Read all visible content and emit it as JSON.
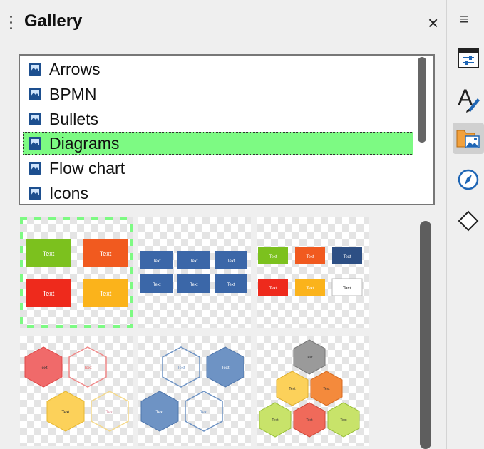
{
  "panel": {
    "title": "Gallery",
    "close_glyph": "×",
    "menu_glyph": "≡"
  },
  "themes": [
    {
      "label": "Arrows",
      "selected": false
    },
    {
      "label": "BPMN",
      "selected": false
    },
    {
      "label": "Bullets",
      "selected": false
    },
    {
      "label": "Diagrams",
      "selected": true
    },
    {
      "label": "Flow chart",
      "selected": false
    },
    {
      "label": "Icons",
      "selected": false
    }
  ],
  "items": [
    {
      "name": "diagram-2x2-blocks",
      "boxes": [
        {
          "label": "Text",
          "color": "#7cc11e"
        },
        {
          "label": "Text",
          "color": "#f15a1f"
        },
        {
          "label": "Text",
          "color": "#ee2a1c"
        },
        {
          "label": "Text",
          "color": "#fbb31b"
        }
      ]
    },
    {
      "name": "diagram-blue-grid",
      "boxes": [
        {
          "label": "Text",
          "color": "#3b67a8"
        },
        {
          "label": "Text",
          "color": "#3b67a8"
        },
        {
          "label": "Text",
          "color": "#3b67a8"
        },
        {
          "label": "Text",
          "color": "#3b67a8"
        },
        {
          "label": "Text",
          "color": "#3b67a8"
        },
        {
          "label": "Text",
          "color": "#3b67a8"
        }
      ]
    },
    {
      "name": "diagram-color-grid",
      "boxes": [
        {
          "label": "Text",
          "color": "#7cc11e"
        },
        {
          "label": "Text",
          "color": "#f15a1f"
        },
        {
          "label": "Text",
          "color": "#2d4f84"
        },
        {
          "label": "Text",
          "color": "#ee2a1c"
        },
        {
          "label": "Text",
          "color": "#fbb31b"
        },
        {
          "label": "Text",
          "color": "#ffffff"
        }
      ]
    },
    {
      "name": "diagram-warm-hexagons",
      "hexes": [
        {
          "label": "Text",
          "color": "#f06a6a"
        },
        {
          "label": "Text",
          "color": "outline-red"
        },
        {
          "label": "Text",
          "color": "#fcd15a"
        },
        {
          "label": "Text",
          "color": "outline-yellow"
        }
      ]
    },
    {
      "name": "diagram-blue-hexagons",
      "hexes": [
        {
          "label": "Text",
          "color": "outline-blue"
        },
        {
          "label": "Text",
          "color": "#6e93c4"
        },
        {
          "label": "Text",
          "color": "#6e93c4"
        },
        {
          "label": "Text",
          "color": "outline-blue"
        }
      ]
    },
    {
      "name": "diagram-hex-pyramid",
      "hexes": [
        {
          "label": "Text",
          "color": "#9a9a9a"
        },
        {
          "label": "Text",
          "color": "#fcd15a"
        },
        {
          "label": "Text",
          "color": "#f48a3c"
        },
        {
          "label": "Text",
          "color": "#c8e36a"
        },
        {
          "label": "Text",
          "color": "#f06a5a"
        },
        {
          "label": "Text",
          "color": "#c8e36a"
        }
      ]
    }
  ],
  "selected_item": "diagram-2x2-blocks",
  "sidebar": [
    {
      "name": "properties-icon",
      "active": false
    },
    {
      "name": "styles-icon",
      "active": false
    },
    {
      "name": "gallery-icon",
      "active": true
    },
    {
      "name": "navigator-icon",
      "active": false
    },
    {
      "name": "shapes-icon",
      "active": false
    }
  ],
  "colors": {
    "selection": "#7dfa83",
    "panel_bg": "#efefef"
  }
}
